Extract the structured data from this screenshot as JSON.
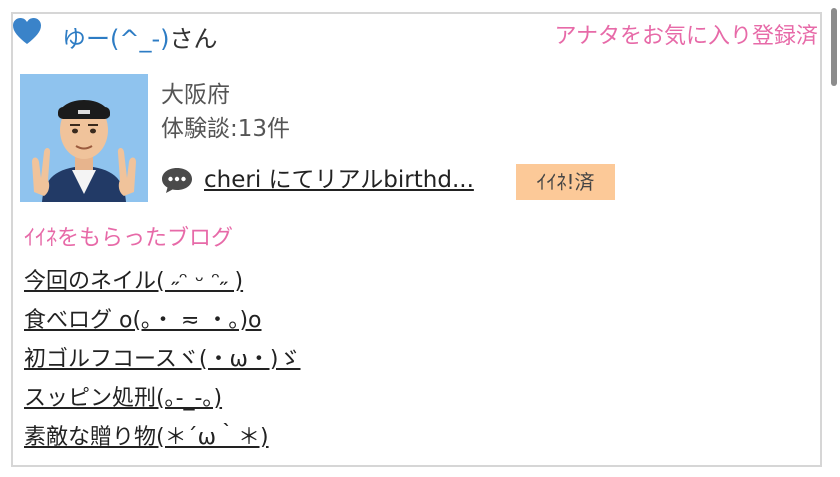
{
  "user": {
    "name": "ゆー(^_-)",
    "honorific": "さん",
    "prefecture": "大阪府",
    "experience_count": "体験談:13件"
  },
  "favorite_link": "アナタをお気に入り登録済",
  "comment": {
    "link_text": "cheri にてリアルbirthd...",
    "badge": "ｲｲﾈ!済"
  },
  "section_title": "ｲｲﾈをもらったブログ",
  "blogs": [
    "今回のネイル( ˶ᵔ ᵕ ᵔ˶ )",
    "食べログ ο(｡・ ≂ ・｡)ο",
    "初ゴルフコースヾ(・ω・)ゞ",
    "スッピン処刑(｡-_-｡)",
    "素敵な贈り物(＊´ω｀＊)"
  ],
  "icons": {
    "heart": "heart-icon",
    "comment": "speech-bubble-icon",
    "avatar": "user-avatar"
  },
  "colors": {
    "accent_pink": "#e76aa8",
    "username_blue": "#2d7cc4",
    "badge_orange": "#fcc998"
  }
}
